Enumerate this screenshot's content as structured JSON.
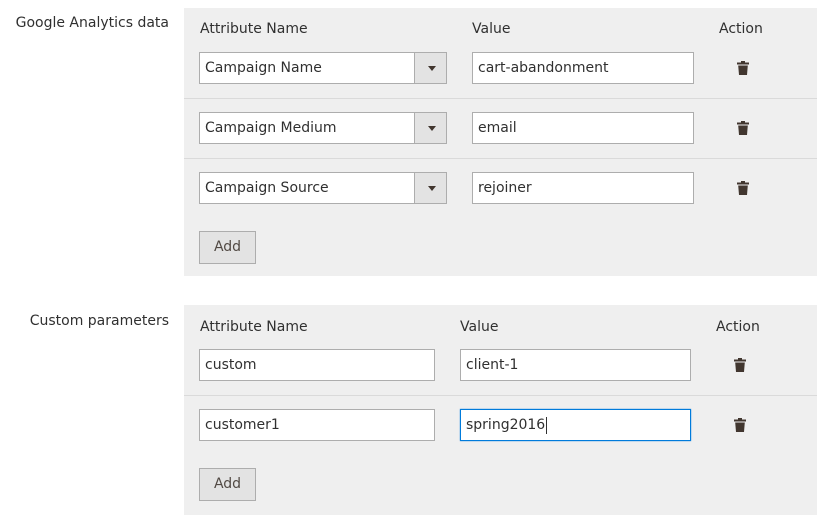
{
  "ga_section": {
    "label": "Google Analytics data",
    "headers": {
      "attribute_name": "Attribute Name",
      "value": "Value",
      "action": "Action"
    },
    "rows": [
      {
        "attribute": "Campaign Name",
        "value": "cart-abandonment"
      },
      {
        "attribute": "Campaign Medium",
        "value": "email"
      },
      {
        "attribute": "Campaign Source",
        "value": "rejoiner"
      }
    ],
    "add_label": "Add"
  },
  "custom_section": {
    "label": "Custom parameters",
    "headers": {
      "attribute_name": "Attribute Name",
      "value": "Value",
      "action": "Action"
    },
    "rows": [
      {
        "attribute": "custom",
        "value": "client-1"
      },
      {
        "attribute": "customer1",
        "value": "spring2016"
      }
    ],
    "add_label": "Add"
  },
  "icons": {
    "delete": "trash-icon",
    "dropdown": "chevron-down-icon"
  },
  "colors": {
    "panel_background": "#efefef",
    "focus_border": "#007bdb",
    "button_background": "#e3e3e3"
  }
}
